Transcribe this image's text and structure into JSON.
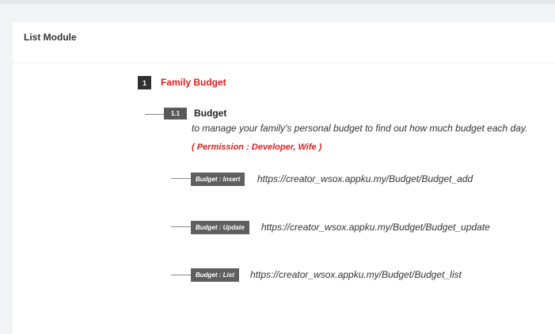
{
  "card": {
    "title": "List Module"
  },
  "module": {
    "number": "1",
    "title": "Family Budget",
    "submodule": {
      "number": "1.1",
      "title": "Budget",
      "description": "to manage your family's personal budget to find out how much budget each day.",
      "permission": "( Permission : Developer, Wife )",
      "routes": [
        {
          "label": "Budget : Insert",
          "url": "https://creator_wsox.appku.my/Budget/Budget_add"
        },
        {
          "label": "Budget : Update",
          "url": "https://creator_wsox.appku.my/Budget/Budget_update"
        },
        {
          "label": "Budget : List",
          "url": "https://creator_wsox.appku.my/Budget/Budget_list"
        }
      ]
    }
  }
}
